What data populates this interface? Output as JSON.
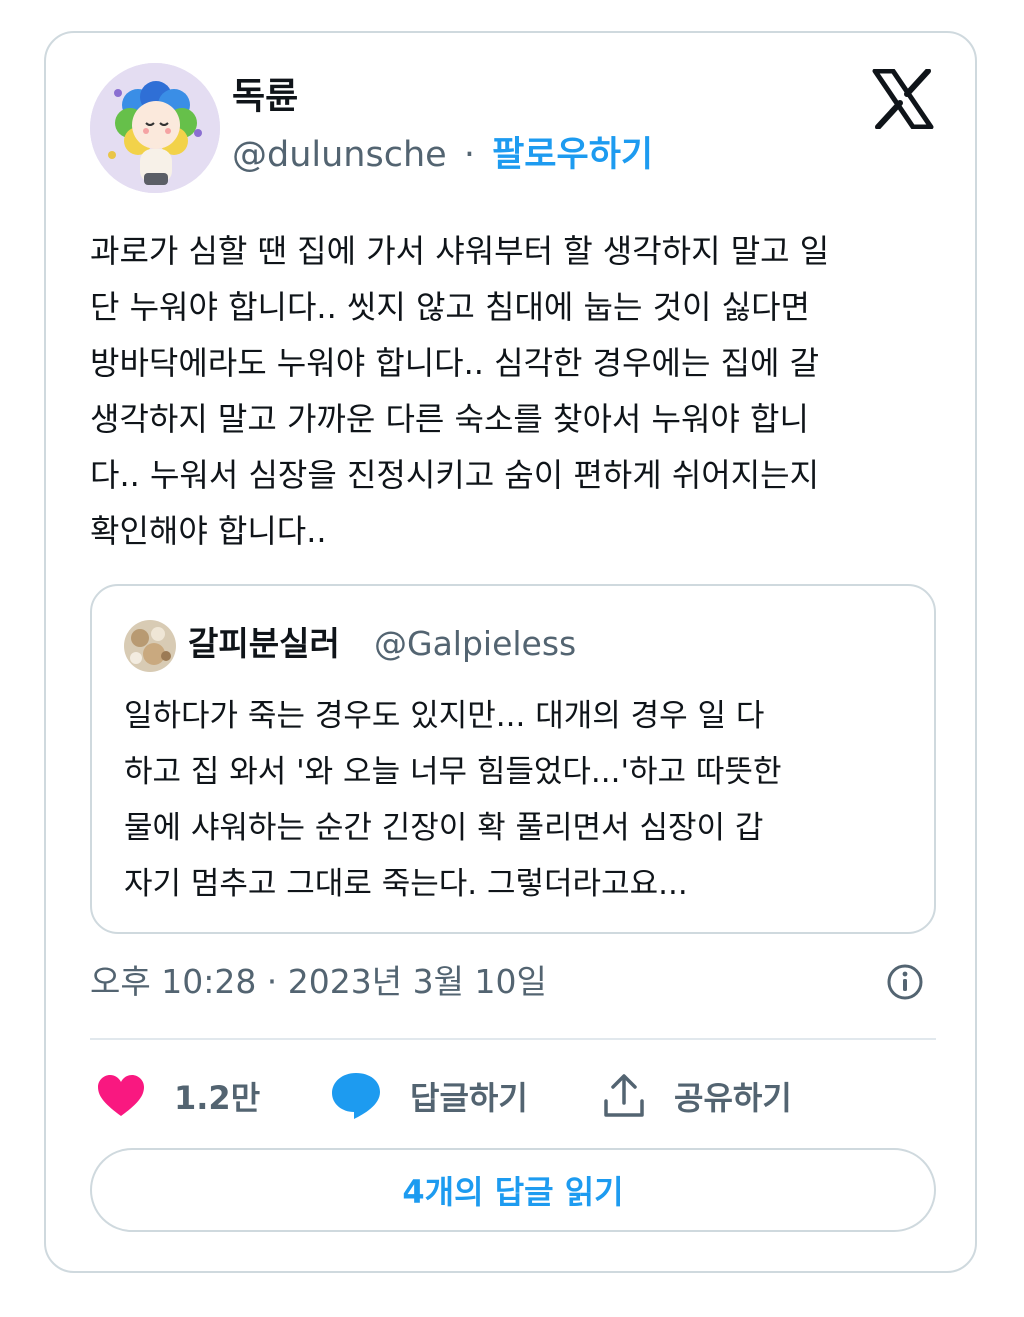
{
  "author": {
    "display_name": "독륜",
    "handle": "@dulunsche",
    "separator": "·",
    "follow_label": "팔로우하기"
  },
  "tweet": {
    "text": "과로가 심할 땐 집에 가서 샤워부터 할 생각하지 말고 일\n단 누워야 합니다.. 씻지 않고 침대에 눕는 것이 싫다면\n방바닥에라도 누워야 합니다.. 심각한 경우에는 집에 갈\n생각하지 말고 가까운 다른 숙소를 찾아서 누워야 합니\n다.. 누워서 심장을 진정시키고 숨이 편하게 쉬어지는지\n확인해야 합니다.."
  },
  "quoted_tweet": {
    "display_name": "갈피분실러",
    "handle": "@Galpieless",
    "text": "일하다가 죽는 경우도 있지만... 대개의 경우 일 다\n하고 집 와서 '와 오늘 너무 힘들었다...'하고 따뜻한\n물에 샤워하는 순간 긴장이 확 풀리면서 심장이 갑\n자기 멈추고 그대로 죽는다. 그렇더라고요..."
  },
  "meta": {
    "timestamp": "오후 10:28 · 2023년 3월 10일"
  },
  "actions": {
    "like_count": "1.2만",
    "reply_label": "답글하기",
    "share_label": "공유하기"
  },
  "read_replies_label": "4개의 답글 읽기",
  "colors": {
    "accent": "#1d9bf0",
    "like": "#f91880",
    "text": "#0f1419",
    "secondary": "#536471",
    "border": "#cfd9de"
  },
  "icons": {
    "brand": "x-logo-icon",
    "like": "heart-icon",
    "reply": "speech-bubble-icon",
    "share": "share-upload-icon",
    "info": "info-icon"
  }
}
